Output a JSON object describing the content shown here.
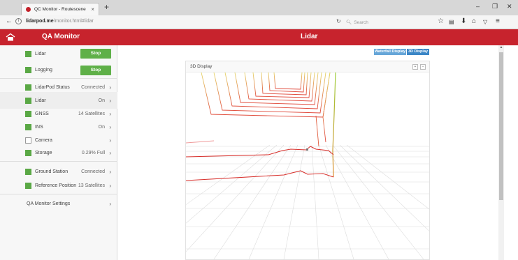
{
  "browser": {
    "tab_title": "QC Monitor - Routescene",
    "tab_close": "×",
    "new_tab": "+",
    "url_domain": "lidarpod.me",
    "url_path": "/monitor.html#lidar",
    "search_placeholder": "Search",
    "window_controls": [
      "–",
      "❐",
      "✕"
    ]
  },
  "app": {
    "title": "QA Monitor",
    "page_title": "Lidar",
    "accent_color": "#c7232d"
  },
  "sidebar": {
    "controls": [
      {
        "label": "Lidar",
        "button": "Stop"
      },
      {
        "label": "Logging",
        "button": "Stop"
      }
    ],
    "status": [
      {
        "label": "LidarPod Status",
        "value": "Connected",
        "checkbox": "green"
      },
      {
        "label": "Lidar",
        "value": "On",
        "checkbox": "green"
      },
      {
        "label": "GNSS",
        "value": "14 Satellites",
        "checkbox": "green"
      },
      {
        "label": "INS",
        "value": "On",
        "checkbox": "green"
      },
      {
        "label": "Camera",
        "value": "",
        "checkbox": "empty"
      },
      {
        "label": "Storage",
        "value": "0.29% Full",
        "checkbox": "green"
      }
    ],
    "ground": [
      {
        "label": "Ground Station",
        "value": "Connected",
        "checkbox": "green"
      },
      {
        "label": "Reference Position",
        "value": "13 Satellites",
        "checkbox": "green"
      }
    ],
    "settings": {
      "label": "QA Monitor Settings"
    }
  },
  "view_toggle": {
    "waterfall": "Waterfall Display",
    "display3d": "3D Display",
    "active": "3D Display"
  },
  "panel": {
    "title": "3D Display",
    "btn_expand": "+",
    "btn_collapse": "–"
  },
  "icons": {
    "back": "arrow-left-icon",
    "info": "info-icon",
    "reload": "reload-icon",
    "search": "search-icon",
    "star": "star-icon",
    "library": "library-icon",
    "download": "download-icon",
    "home": "home-icon",
    "pocket": "pocket-icon",
    "menu": "hamburger-menu-icon",
    "chevron": "chevron-right-icon"
  }
}
